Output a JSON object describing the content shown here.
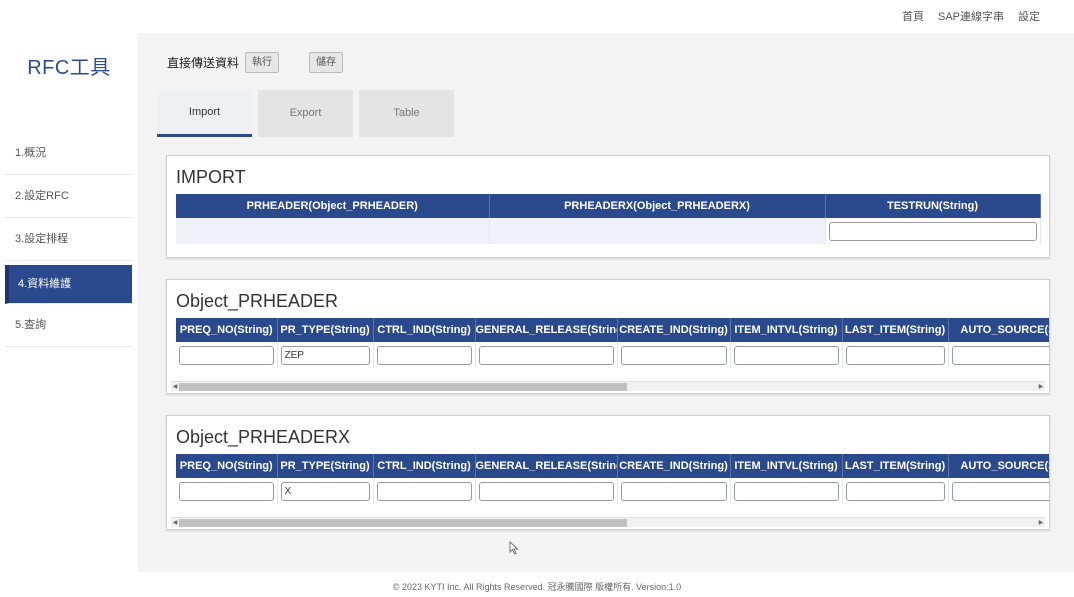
{
  "topnav": {
    "links": [
      "首頁",
      "SAP連線字串",
      "設定"
    ]
  },
  "sidebar": {
    "brand": "RFC工具",
    "items": [
      {
        "label": "1.概況"
      },
      {
        "label": "2.設定RFC"
      },
      {
        "label": "3.設定排程"
      },
      {
        "label": "4.資料維護",
        "active": true
      },
      {
        "label": "5.查詢"
      }
    ]
  },
  "main": {
    "heading": "直接傳送資料",
    "run_label": "執行",
    "save_label": "儲存",
    "tabs": [
      {
        "label": "Import",
        "active": true
      },
      {
        "label": "Export"
      },
      {
        "label": "Table"
      }
    ]
  },
  "import_panel": {
    "title": "IMPORT",
    "columns": [
      "PRHEADER(Object_PRHEADER)",
      "PRHEADERX(Object_PRHEADERX)",
      "TESTRUN(String)"
    ],
    "testrun_value": ""
  },
  "prheader_panel": {
    "title": "Object_PRHEADER",
    "columns": [
      "PREQ_NO(String)",
      "PR_TYPE(String)",
      "CTRL_IND(String)",
      "GENERAL_RELEASE(String)",
      "CREATE_IND(String)",
      "ITEM_INTVL(String)",
      "LAST_ITEM(String)",
      "AUTO_SOURCE(String)"
    ],
    "values": [
      "",
      "ZEP",
      "",
      "",
      "",
      "",
      "",
      ""
    ]
  },
  "prheaderx_panel": {
    "title": "Object_PRHEADERX",
    "columns": [
      "PREQ_NO(String)",
      "PR_TYPE(String)",
      "CTRL_IND(String)",
      "GENERAL_RELEASE(String)",
      "CREATE_IND(String)",
      "ITEM_INTVL(String)",
      "LAST_ITEM(String)",
      "AUTO_SOURCE(String)"
    ],
    "values": [
      "",
      "X",
      "",
      "",
      "",
      "",
      "",
      ""
    ]
  },
  "footer": {
    "text": "© 2023 KYTI Inc. All Rights Reserved. 冠永騰國際 版權所有. Version:1.0"
  },
  "colors": {
    "primary": "#2b4a8e",
    "brand_text": "#2a4d8f"
  }
}
